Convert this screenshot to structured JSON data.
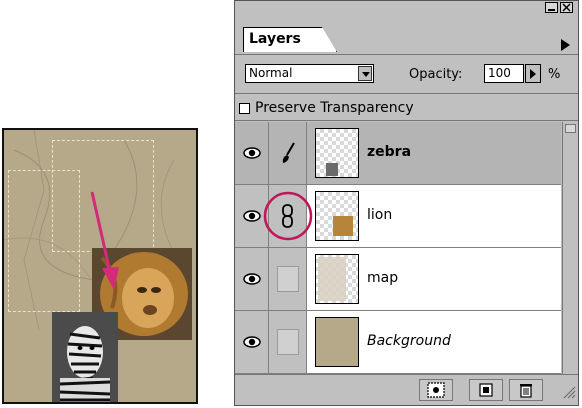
{
  "panel": {
    "tab_label": "Layers",
    "blend_mode": "Normal",
    "opacity_label": "Opacity:",
    "opacity_value": "100",
    "opacity_unit": "%",
    "preserve_transparency_label": "Preserve Transparency",
    "preserve_transparency_checked": false,
    "titlebar_buttons": [
      "minimize-icon",
      "close-icon"
    ]
  },
  "layers": [
    {
      "name": "zebra",
      "active": true,
      "visible": true,
      "link_state": "brush",
      "thumb": "zebra"
    },
    {
      "name": "lion",
      "active": false,
      "visible": true,
      "link_state": "linked",
      "thumb": "lion"
    },
    {
      "name": "map",
      "active": false,
      "visible": true,
      "link_state": "none",
      "thumb": "map"
    },
    {
      "name": "Background",
      "active": false,
      "visible": true,
      "link_state": "none",
      "thumb": "background"
    }
  ],
  "footer_buttons": [
    "layer-mask-icon",
    "new-layer-icon",
    "trash-icon"
  ],
  "colors": {
    "panel_bg": "#c0c0c0",
    "active_row": "#b8b8b8",
    "highlight_circle": "#c0175a",
    "arrow": "#d42a7a",
    "canvas_bg": "#b6a98a"
  }
}
